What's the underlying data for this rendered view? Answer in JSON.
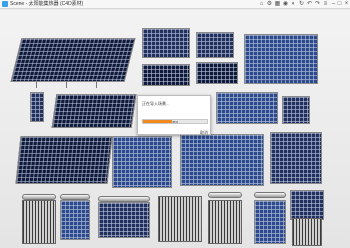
{
  "window": {
    "title": "Scene - 太阳能集热器 (C4D素材)",
    "icons": {
      "app": "app-icon",
      "minimize": "minimize-icon",
      "maximize": "maximize-icon",
      "close": "close-icon"
    },
    "toolbar_icons": [
      "home-icon",
      "settings-icon",
      "grid-icon",
      "camera-icon",
      "eye-icon",
      "refresh-icon",
      "undo-icon",
      "redo-icon",
      "menu-icon"
    ],
    "toolbar_glyphs": [
      "⌂",
      "⚙",
      "▦",
      "◉",
      "◐",
      "↻",
      "↶",
      "↷",
      "≡"
    ],
    "controls": [
      "–",
      "□",
      "×"
    ]
  },
  "dialog": {
    "title": "正在导入场景...",
    "progress_fraction": 0.45,
    "progress_text": "45%",
    "cancel_label": "取消"
  },
  "colors": {
    "accent": "#f08a1c",
    "panel": "#22305e"
  }
}
